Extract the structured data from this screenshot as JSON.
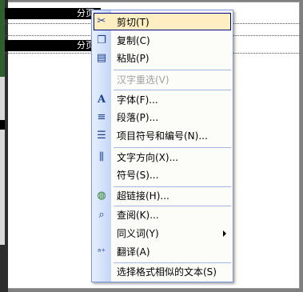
{
  "background": {
    "section_breaks": [
      {
        "label": "分页符"
      },
      {
        "label": "分页"
      }
    ]
  },
  "menu": {
    "items": [
      {
        "label": "剪切(T)",
        "icon": "scissors-icon",
        "glyph": "✂",
        "state": "hover"
      },
      {
        "label": "复制(C)",
        "icon": "copy-icon",
        "glyph": "❐"
      },
      {
        "label": "粘贴(P)",
        "icon": "paste-icon",
        "glyph": "📋"
      },
      {
        "label": "汉字重选(V)",
        "state": "disabled"
      },
      {
        "label": "字体(F)...",
        "icon": "font-icon",
        "glyph": "A"
      },
      {
        "label": "段落(P)...",
        "icon": "paragraph-icon",
        "glyph": "≡"
      },
      {
        "label": "项目符号和编号(N)...",
        "icon": "bullets-icon",
        "glyph": "☰"
      },
      {
        "label": "文字方向(X)...",
        "icon": "text-direction-icon",
        "glyph": "⫼"
      },
      {
        "label": "符号(S)..."
      },
      {
        "label": "超链接(H)...",
        "icon": "hyperlink-icon",
        "glyph": "🌐"
      },
      {
        "label": "查阅(K)...",
        "icon": "research-icon",
        "glyph": "🔍"
      },
      {
        "label": "同义词(Y)",
        "submenu": true
      },
      {
        "label": "翻译(A)",
        "icon": "translate-icon",
        "glyph": "ᵃ⁺"
      },
      {
        "label": "选择格式相似的文本(S)"
      }
    ]
  }
}
